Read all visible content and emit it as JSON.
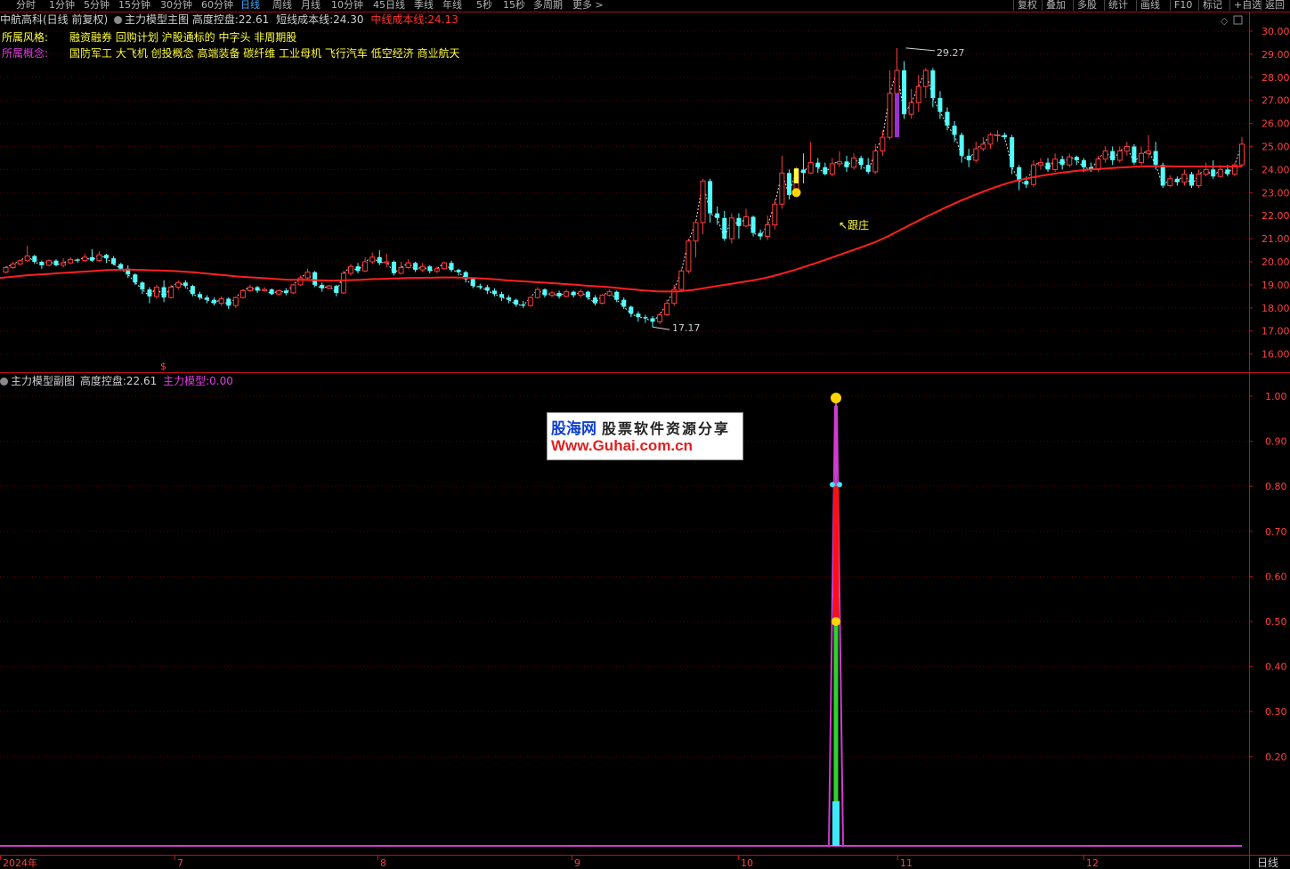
{
  "toolbar": {
    "periods": [
      "分时",
      "1分钟",
      "5分钟",
      "15分钟",
      "30分钟",
      "60分钟",
      "日线",
      "周线",
      "月线",
      "10分钟",
      "45日线",
      "季线",
      "年线",
      "5秒",
      "15秒",
      "多周期",
      "更多 >"
    ],
    "active_period": "日线",
    "tools": [
      "复权",
      "叠加",
      "多股",
      "统计",
      "画线",
      "F10",
      "标记",
      "+自选",
      "返回"
    ]
  },
  "main_header": {
    "stock": "中航高科(日线 前复权)",
    "indicator": "主力模型主图",
    "kongpan_label": "高度控盘:",
    "kongpan_value": "22.61",
    "short_label": "短线成本线:",
    "short_value": "24.30",
    "mid_label": "中线成本线:",
    "mid_value": "24.13"
  },
  "info": {
    "style_label": "所属风格:",
    "style_value": "融资融券 回购计划 沪股通标的 中字头 非周期股",
    "concept_label": "所属概念:",
    "concept_value": "国防军工 大飞机 创投概念 高端装备 碳纤维 工业母机 飞行汽车 低空经济 商业航天"
  },
  "annotations": {
    "high_label": "29.27",
    "low_label": "17.17",
    "follow_label": "跟庄"
  },
  "sub_header": {
    "indicator": "主力模型副图",
    "kongpan_label": "高度控盘:",
    "kongpan_value": "22.61",
    "model_label": "主力模型:",
    "model_value": "0.00"
  },
  "watermark": {
    "line1_a": "股海网",
    "line1_b": "股票软件资源分享",
    "line2": "Www.Guhai.com.cn"
  },
  "axis": {
    "price_ticks": [
      "30.00",
      "29.00",
      "28.00",
      "27.00",
      "26.00",
      "25.00",
      "24.00",
      "23.00",
      "22.00",
      "21.00",
      "20.00",
      "19.00",
      "18.00",
      "17.00",
      "16.00"
    ],
    "sub_ticks": [
      "1.00",
      "0.90",
      "0.80",
      "0.70",
      "0.60",
      "0.50",
      "0.40",
      "0.30",
      "0.20"
    ],
    "date_labels": [
      "2024年",
      "7",
      "8",
      "9",
      "10",
      "11",
      "12"
    ],
    "period_label": "日线"
  },
  "colors": {
    "up": "#ff3b3b",
    "down": "#54ffff",
    "ma": "#ff2020",
    "grid": "#5a0000",
    "axis_text": "#ff4040",
    "purple": "#d03cd0",
    "yellow": "#ffff40"
  },
  "chart_data": {
    "type": "candlestick",
    "y_range": [
      16,
      30
    ],
    "high": 29.27,
    "low": 17.17,
    "ohlc": [
      [
        19.55,
        19.75,
        19.5,
        19.8
      ],
      [
        19.75,
        19.9,
        19.7,
        20.0
      ],
      [
        19.9,
        20.05,
        19.85,
        20.1
      ],
      [
        20.05,
        20.25,
        20.0,
        20.7
      ],
      [
        20.25,
        20.0,
        19.9,
        20.3
      ],
      [
        20.0,
        19.85,
        19.7,
        20.05
      ],
      [
        19.85,
        20.05,
        19.8,
        20.1
      ],
      [
        20.05,
        19.85,
        19.8,
        20.1
      ],
      [
        19.85,
        19.95,
        19.75,
        20.15
      ],
      [
        19.95,
        20.1,
        19.9,
        20.2
      ],
      [
        20.1,
        20.05,
        19.95,
        20.15
      ],
      [
        20.05,
        20.2,
        20.0,
        20.35
      ],
      [
        20.2,
        20.05,
        20.0,
        20.55
      ],
      [
        20.05,
        20.3,
        20.0,
        20.45
      ],
      [
        20.3,
        20.15,
        19.95,
        20.35
      ],
      [
        20.15,
        19.9,
        19.85,
        20.25
      ],
      [
        19.9,
        19.7,
        19.6,
        19.95
      ],
      [
        19.7,
        19.45,
        19.3,
        19.85
      ],
      [
        19.45,
        19.1,
        19.0,
        19.5
      ],
      [
        19.1,
        18.8,
        18.6,
        19.15
      ],
      [
        18.8,
        18.5,
        18.2,
        18.9
      ],
      [
        18.5,
        18.9,
        18.4,
        19.0
      ],
      [
        18.9,
        18.45,
        18.25,
        19.2
      ],
      [
        18.45,
        18.9,
        18.4,
        19.0
      ],
      [
        18.9,
        19.1,
        18.8,
        19.2
      ],
      [
        19.1,
        18.95,
        18.85,
        19.2
      ],
      [
        18.95,
        18.6,
        18.5,
        19.0
      ],
      [
        18.6,
        18.45,
        18.35,
        18.7
      ],
      [
        18.45,
        18.35,
        18.2,
        18.55
      ],
      [
        18.35,
        18.2,
        18.1,
        18.45
      ],
      [
        18.2,
        18.4,
        18.1,
        18.5
      ],
      [
        18.4,
        18.1,
        17.95,
        18.45
      ],
      [
        18.1,
        18.45,
        18.0,
        18.5
      ],
      [
        18.45,
        18.75,
        18.4,
        18.8
      ],
      [
        18.75,
        18.9,
        18.7,
        19.0
      ],
      [
        18.9,
        18.75,
        18.65,
        18.95
      ],
      [
        18.75,
        18.8,
        18.7,
        18.9
      ],
      [
        18.8,
        18.6,
        18.55,
        18.85
      ],
      [
        18.6,
        18.75,
        18.55,
        18.8
      ],
      [
        18.75,
        18.65,
        18.55,
        18.85
      ],
      [
        18.65,
        19.0,
        18.6,
        19.05
      ],
      [
        19.0,
        19.3,
        18.95,
        19.4
      ],
      [
        19.3,
        19.55,
        19.2,
        19.7
      ],
      [
        19.55,
        19.0,
        18.9,
        19.6
      ],
      [
        19.0,
        18.85,
        18.7,
        19.1
      ],
      [
        18.85,
        18.95,
        18.8,
        19.0
      ],
      [
        18.95,
        18.65,
        18.5,
        19.0
      ],
      [
        18.65,
        19.5,
        18.6,
        19.6
      ],
      [
        19.5,
        19.8,
        19.4,
        19.9
      ],
      [
        19.8,
        19.6,
        19.5,
        19.95
      ],
      [
        19.6,
        20.0,
        19.55,
        20.2
      ],
      [
        20.0,
        20.2,
        19.9,
        20.4
      ],
      [
        20.2,
        19.95,
        19.85,
        20.5
      ],
      [
        19.95,
        20.0,
        19.75,
        20.35
      ],
      [
        20.0,
        19.5,
        19.4,
        20.05
      ],
      [
        19.5,
        19.75,
        19.45,
        20.0
      ],
      [
        19.75,
        19.95,
        19.7,
        20.1
      ],
      [
        19.95,
        19.65,
        19.55,
        20.0
      ],
      [
        19.65,
        19.8,
        19.55,
        19.95
      ],
      [
        19.8,
        19.6,
        19.5,
        19.85
      ],
      [
        19.6,
        19.7,
        19.5,
        19.8
      ],
      [
        19.7,
        19.95,
        19.65,
        20.0
      ],
      [
        19.95,
        19.65,
        19.55,
        20.05
      ],
      [
        19.65,
        19.55,
        19.4,
        19.7
      ],
      [
        19.55,
        19.25,
        19.1,
        19.6
      ],
      [
        19.25,
        18.95,
        18.85,
        19.3
      ],
      [
        18.95,
        18.9,
        18.8,
        19.05
      ],
      [
        18.9,
        18.75,
        18.6,
        19.0
      ],
      [
        18.75,
        18.6,
        18.5,
        18.85
      ],
      [
        18.6,
        18.45,
        18.3,
        18.7
      ],
      [
        18.45,
        18.35,
        18.2,
        18.55
      ],
      [
        18.35,
        18.15,
        18.05,
        18.4
      ],
      [
        18.15,
        18.1,
        18.0,
        18.3
      ],
      [
        18.1,
        18.45,
        18.05,
        18.5
      ],
      [
        18.45,
        18.8,
        18.4,
        18.9
      ],
      [
        18.8,
        18.55,
        18.45,
        18.85
      ],
      [
        18.55,
        18.65,
        18.45,
        18.75
      ],
      [
        18.65,
        18.5,
        18.4,
        18.75
      ],
      [
        18.5,
        18.7,
        18.45,
        18.8
      ],
      [
        18.7,
        18.55,
        18.45,
        18.75
      ],
      [
        18.55,
        18.7,
        18.45,
        18.8
      ],
      [
        18.7,
        18.45,
        18.35,
        18.75
      ],
      [
        18.45,
        18.2,
        18.1,
        18.55
      ],
      [
        18.2,
        18.55,
        18.15,
        18.6
      ],
      [
        18.55,
        18.7,
        18.5,
        18.8
      ],
      [
        18.7,
        18.35,
        18.25,
        18.75
      ],
      [
        18.35,
        18.05,
        17.95,
        18.45
      ],
      [
        18.05,
        17.75,
        17.6,
        18.1
      ],
      [
        17.75,
        17.6,
        17.4,
        17.85
      ],
      [
        17.6,
        17.55,
        17.35,
        17.7
      ],
      [
        17.55,
        17.4,
        17.17,
        17.65
      ],
      [
        17.4,
        17.7,
        17.3,
        17.8
      ],
      [
        17.7,
        18.2,
        17.65,
        18.35
      ],
      [
        18.2,
        18.8,
        18.1,
        19.0
      ],
      [
        18.8,
        19.6,
        18.75,
        19.7
      ],
      [
        19.6,
        20.9,
        19.5,
        21.0
      ],
      [
        20.9,
        21.7,
        20.2,
        21.8
      ],
      [
        21.7,
        23.5,
        21.2,
        23.6
      ],
      [
        23.5,
        22.1,
        21.7,
        23.6
      ],
      [
        22.1,
        21.9,
        21.6,
        22.4
      ],
      [
        21.9,
        21.0,
        20.9,
        22.2
      ],
      [
        21.0,
        21.9,
        20.8,
        22.1
      ],
      [
        21.9,
        21.55,
        21.0,
        22.1
      ],
      [
        21.55,
        21.95,
        21.5,
        22.3
      ],
      [
        21.95,
        21.25,
        21.1,
        22.0
      ],
      [
        21.25,
        21.1,
        20.95,
        21.4
      ],
      [
        21.1,
        21.6,
        20.95,
        22.0
      ],
      [
        21.6,
        22.5,
        21.4,
        22.7
      ],
      [
        22.5,
        23.85,
        22.3,
        24.6
      ],
      [
        23.85,
        22.9,
        22.7,
        24.0
      ],
      [
        22.9,
        24.0,
        22.8,
        24.1
      ],
      [
        24.0,
        23.85,
        23.4,
        24.7
      ],
      [
        23.85,
        24.3,
        23.8,
        25.2
      ],
      [
        24.3,
        24.1,
        23.85,
        24.5
      ],
      [
        24.1,
        23.8,
        23.75,
        24.3
      ],
      [
        23.8,
        24.25,
        23.7,
        24.5
      ],
      [
        24.25,
        24.35,
        24.1,
        24.8
      ],
      [
        24.35,
        24.1,
        23.9,
        24.6
      ],
      [
        24.1,
        24.5,
        24.0,
        24.7
      ],
      [
        24.5,
        24.2,
        24.0,
        24.6
      ],
      [
        24.2,
        23.9,
        23.8,
        24.5
      ],
      [
        23.9,
        24.8,
        23.8,
        25.1
      ],
      [
        24.8,
        25.4,
        24.6,
        25.7
      ],
      [
        25.4,
        27.3,
        25.3,
        28.3
      ],
      [
        27.3,
        28.3,
        27.1,
        29.27
      ],
      [
        28.3,
        26.4,
        26.2,
        28.7
      ],
      [
        26.4,
        26.9,
        26.2,
        27.5
      ],
      [
        26.9,
        27.6,
        26.5,
        28.1
      ],
      [
        27.6,
        28.3,
        27.1,
        28.4
      ],
      [
        28.3,
        27.1,
        26.7,
        28.4
      ],
      [
        27.1,
        26.5,
        26.2,
        27.4
      ],
      [
        26.5,
        25.9,
        25.7,
        26.7
      ],
      [
        25.9,
        25.5,
        25.2,
        26.1
      ],
      [
        25.5,
        24.6,
        24.3,
        25.6
      ],
      [
        24.6,
        24.4,
        24.1,
        24.9
      ],
      [
        24.4,
        24.9,
        24.3,
        25.2
      ],
      [
        24.9,
        25.1,
        24.8,
        25.4
      ],
      [
        25.1,
        25.5,
        24.9,
        25.6
      ],
      [
        25.5,
        25.5,
        25.2,
        25.7
      ],
      [
        25.5,
        25.4,
        25.3,
        25.6
      ],
      [
        25.4,
        24.1,
        23.8,
        25.5
      ],
      [
        24.1,
        23.5,
        23.1,
        24.2
      ],
      [
        23.5,
        23.35,
        23.2,
        23.7
      ],
      [
        23.35,
        24.2,
        23.25,
        24.4
      ],
      [
        24.2,
        24.3,
        24.0,
        24.5
      ],
      [
        24.3,
        24.0,
        23.9,
        24.5
      ],
      [
        24.0,
        24.45,
        23.9,
        24.7
      ],
      [
        24.45,
        24.2,
        24.0,
        24.6
      ],
      [
        24.2,
        24.55,
        24.1,
        24.7
      ],
      [
        24.55,
        24.4,
        24.2,
        24.6
      ],
      [
        24.4,
        24.1,
        23.9,
        24.5
      ],
      [
        24.1,
        24.0,
        23.9,
        24.3
      ],
      [
        24.0,
        24.45,
        23.9,
        24.6
      ],
      [
        24.45,
        24.8,
        24.3,
        25.0
      ],
      [
        24.8,
        24.4,
        24.2,
        25.0
      ],
      [
        24.4,
        24.8,
        24.3,
        25.0
      ],
      [
        24.8,
        25.0,
        24.6,
        25.2
      ],
      [
        25.0,
        24.3,
        24.2,
        25.1
      ],
      [
        24.3,
        24.7,
        24.2,
        25.0
      ],
      [
        24.7,
        24.8,
        24.5,
        25.5
      ],
      [
        24.8,
        24.2,
        24.0,
        25.2
      ],
      [
        24.2,
        23.3,
        23.2,
        24.3
      ],
      [
        23.3,
        23.6,
        23.25,
        23.75
      ],
      [
        23.6,
        23.45,
        23.3,
        23.7
      ],
      [
        23.45,
        23.8,
        23.3,
        24.0
      ],
      [
        23.8,
        23.3,
        23.2,
        23.9
      ],
      [
        23.3,
        23.8,
        23.2,
        24.0
      ],
      [
        23.8,
        24.0,
        23.7,
        24.3
      ],
      [
        24.0,
        23.7,
        23.6,
        24.4
      ],
      [
        23.7,
        24.0,
        23.65,
        24.2
      ],
      [
        24.0,
        23.8,
        23.7,
        24.2
      ],
      [
        23.8,
        24.2,
        23.7,
        24.3
      ],
      [
        24.2,
        25.1,
        24.1,
        25.4
      ]
    ],
    "ma": [
      19.3,
      19.33,
      19.36,
      19.39,
      19.42,
      19.44,
      19.46,
      19.48,
      19.5,
      19.52,
      19.54,
      19.56,
      19.58,
      19.6,
      19.62,
      19.64,
      19.65,
      19.66,
      19.66,
      19.65,
      19.64,
      19.63,
      19.62,
      19.61,
      19.6,
      19.58,
      19.56,
      19.54,
      19.51,
      19.48,
      19.45,
      19.42,
      19.39,
      19.36,
      19.34,
      19.32,
      19.3,
      19.28,
      19.26,
      19.24,
      19.22,
      19.22,
      19.22,
      19.21,
      19.2,
      19.19,
      19.18,
      19.19,
      19.2,
      19.21,
      19.22,
      19.24,
      19.25,
      19.26,
      19.27,
      19.28,
      19.29,
      19.3,
      19.3,
      19.31,
      19.31,
      19.32,
      19.32,
      19.32,
      19.31,
      19.3,
      19.29,
      19.27,
      19.25,
      19.23,
      19.2,
      19.18,
      19.16,
      19.14,
      19.12,
      19.1,
      19.08,
      19.06,
      19.04,
      19.02,
      19.0,
      18.97,
      18.95,
      18.93,
      18.91,
      18.88,
      18.85,
      18.82,
      18.79,
      18.76,
      18.74,
      18.72,
      18.71,
      18.71,
      18.72,
      18.75,
      18.78,
      18.83,
      18.88,
      18.93,
      18.98,
      19.03,
      19.08,
      19.13,
      19.18,
      19.23,
      19.3,
      19.38,
      19.46,
      19.55,
      19.64,
      19.74,
      19.84,
      19.94,
      20.05,
      20.16,
      20.27,
      20.38,
      20.49,
      20.6,
      20.71,
      20.83,
      20.96,
      21.11,
      21.27,
      21.43,
      21.59,
      21.75,
      21.91,
      22.06,
      22.21,
      22.36,
      22.5,
      22.64,
      22.77,
      22.9,
      23.02,
      23.14,
      23.25,
      23.35,
      23.45,
      23.53,
      23.6,
      23.66,
      23.72,
      23.77,
      23.82,
      23.86,
      23.9,
      23.94,
      23.97,
      24.0,
      24.02,
      24.04,
      24.06,
      24.08,
      24.1,
      24.12,
      24.13,
      24.14,
      24.14,
      24.14,
      24.14,
      24.13,
      24.13,
      24.13,
      24.13,
      24.13,
      24.13,
      24.13,
      24.13,
      24.13,
      24.13
    ],
    "sub_series": {
      "name": "主力模型",
      "peak": 1.0,
      "current": 0.0
    }
  }
}
